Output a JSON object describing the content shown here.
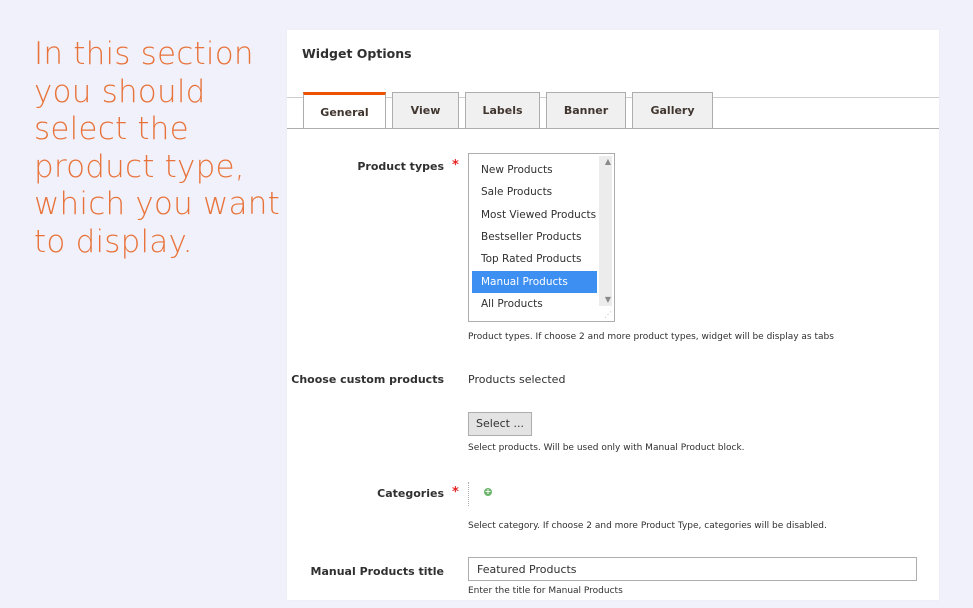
{
  "caption": "In this section you should select the product type, which you want to display.",
  "colors": {
    "accent_text": "#e8733a",
    "active_tab_border": "#eb5202",
    "selected_option": "#3d8ff2",
    "required_star": "#e22626"
  },
  "panel": {
    "title": "Widget Options",
    "tabs": [
      {
        "label": "General",
        "active": true
      },
      {
        "label": "View",
        "active": false
      },
      {
        "label": "Labels",
        "active": false
      },
      {
        "label": "Banner",
        "active": false
      },
      {
        "label": "Gallery",
        "active": false
      }
    ]
  },
  "product_types": {
    "label": "Product types",
    "required_mark": "*",
    "options": [
      "New Products",
      "Sale Products",
      "Most Viewed Products",
      "Bestseller Products",
      "Top Rated Products",
      "Manual Products",
      "All Products"
    ],
    "selected": "Manual Products",
    "note": "Product types. If choose 2 and more product types, widget will be display as tabs"
  },
  "custom_products": {
    "label": "Choose custom products",
    "value": "Products selected",
    "button_label": "Select ...",
    "note": "Select products. Will be used only with Manual Product block."
  },
  "categories": {
    "label": "Categories",
    "required_mark": "*",
    "tree_icon": "plus-circle-icon",
    "note": "Select category. If choose 2 and more Product Type, categories will be disabled."
  },
  "manual_title": {
    "label": "Manual Products title",
    "value": "Featured Products",
    "note": "Enter the title for Manual Products"
  }
}
